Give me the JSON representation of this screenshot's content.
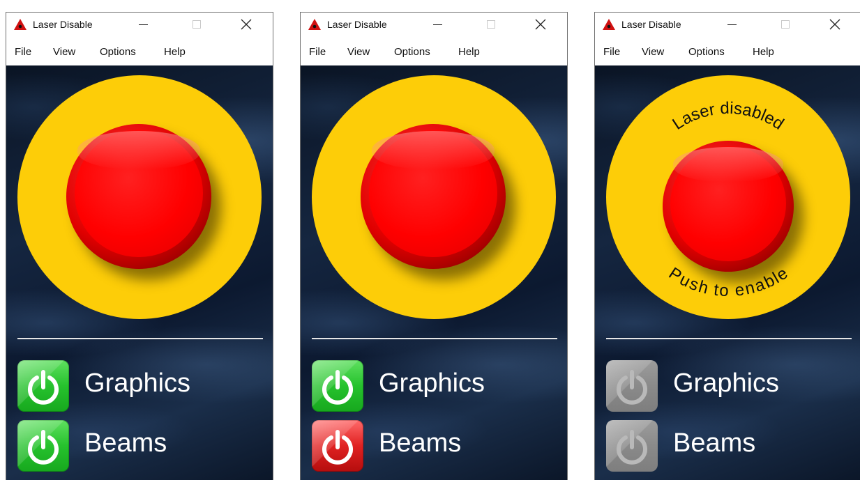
{
  "windows": [
    {
      "title": "Laser Disable",
      "menu": [
        "File",
        "View",
        "Options",
        "Help"
      ],
      "estop": {
        "top_label": "",
        "bottom_label": ""
      },
      "toggles": [
        {
          "label": "Graphics",
          "state": "on",
          "color": "#26c22d"
        },
        {
          "label": "Beams",
          "state": "on",
          "color": "#26c22d"
        }
      ]
    },
    {
      "title": "Laser Disable",
      "menu": [
        "File",
        "View",
        "Options",
        "Help"
      ],
      "estop": {
        "top_label": "",
        "bottom_label": ""
      },
      "toggles": [
        {
          "label": "Graphics",
          "state": "on",
          "color": "#26c22d"
        },
        {
          "label": "Beams",
          "state": "off",
          "color": "#e02222"
        }
      ]
    },
    {
      "title": "Laser Disable",
      "menu": [
        "File",
        "View",
        "Options",
        "Help"
      ],
      "estop": {
        "top_label": "Laser disabled",
        "bottom_label": "Push to enable"
      },
      "toggles": [
        {
          "label": "Graphics",
          "state": "disabled",
          "color": "#8a8a8a"
        },
        {
          "label": "Beams",
          "state": "disabled",
          "color": "#8a8a8a"
        }
      ]
    }
  ],
  "colors": {
    "ring": "#fdcd08",
    "button_red": "#ff0000",
    "icon_triangle": "#d01010"
  },
  "icons": {
    "app": "laser-warning-icon",
    "toggle": "power-icon"
  }
}
